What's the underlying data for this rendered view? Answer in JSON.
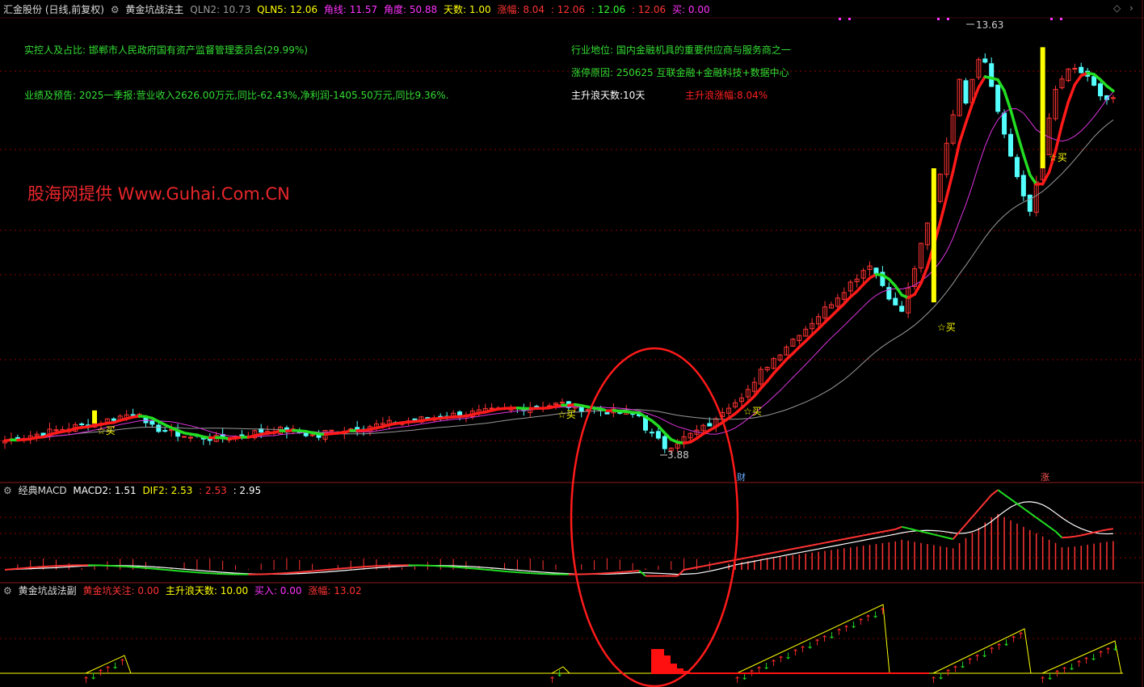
{
  "colors": {
    "up": "#ff3333",
    "down": "#54ffff",
    "main_wave": "#ff1a1a",
    "pullback": "#22dd22",
    "ma_magenta": "#dd33dd",
    "ma_grey": "#999999",
    "signal_yellow": "#ffff00",
    "grid": "#8b0000"
  },
  "icons": {
    "collapse": "gear-icon",
    "nav_left": "chevron-left-icon",
    "nav_right": "chevron-right-icon"
  },
  "main_header": {
    "stock": "汇金股份 (日线,前复权)",
    "indicator": "黄金坑战法主",
    "qln2_label": "QLN2:",
    "qln2_value": "10.73",
    "qln5_label": "QLN5:",
    "qln5_value": "12.06",
    "jiaoxian_label": "角线:",
    "jiaoxian_value": "11.57",
    "jiaodu_label": "角度:",
    "jiaodu_value": "50.88",
    "tianshu_label": "天数:",
    "tianshu_value": "1.00",
    "zhangfu_label": "涨幅:",
    "zhangfu_value": "8.04",
    "extra1": ": 12.06",
    "extra2": ": 12.06",
    "extra3": ": 12.06",
    "mai_label": "买:",
    "mai_value": "0.00"
  },
  "annotations": {
    "controller": "实控人及占比: 邯郸市人民政府国有资产监督管理委员会(29.99%)",
    "earnings": "业绩及预告: 2025一季报:营业收入2626.00万元,同比-62.43%,净利润-1405.50万元,同比9.36%.",
    "industry": "行业地位: 国内金融机具的重要供应商与服务商之一",
    "limit_reason": "涨停原因: 250625 互联金融+金融科技+数据中心",
    "wave_days": "主升浪天数:10天",
    "wave_gain": "主升浪涨幅:8.04%",
    "watermark": "股海网提供 Www.Guhai.Com.CN"
  },
  "macd_header": {
    "name": "经典MACD",
    "macd_label": "MACD2:",
    "macd_value": "1.51",
    "dif_label": "DIF2:",
    "dif_value": "2.53",
    "v2": ": 2.53",
    "v3": ": 2.95"
  },
  "sub_header": {
    "name": "黄金坑战法副",
    "focus_label": "黄金坑关注:",
    "focus_value": "0.00",
    "days_label": "主升浪天数:",
    "days_value": "10.00",
    "buy_label": "买入:",
    "buy_value": "0.00",
    "gain_label": "涨幅:",
    "gain_value": "13.02"
  },
  "chart_data": [
    {
      "type": "candlestick",
      "title": "汇金股份 (日线,前复权)",
      "price_labels": {
        "high": "13.63",
        "low": "3.88"
      },
      "high": 13.63,
      "low": 3.88,
      "buy_marks": [
        "☆买",
        "☆买",
        "☆买",
        "☆买",
        "☆买"
      ],
      "event_marks": [
        "财",
        "涨"
      ],
      "ohlc_summary": "sideways ~4.4-5.0 for most of the range, dip to 3.88, then a strong rally to 13.63 with a pullback to ~9 and recovery near 12"
    },
    {
      "type": "line",
      "title": "经典MACD",
      "series": [
        {
          "name": "MACD2",
          "last": 1.51
        },
        {
          "name": "DIF2",
          "last": 2.53
        }
      ]
    },
    {
      "type": "bar",
      "title": "黄金坑战法副",
      "series": [
        {
          "name": "黄金坑关注",
          "last": 0.0
        },
        {
          "name": "主升浪天数",
          "last": 10.0
        },
        {
          "name": "买入",
          "last": 0.0
        },
        {
          "name": "涨幅",
          "last": 13.02
        }
      ]
    }
  ]
}
